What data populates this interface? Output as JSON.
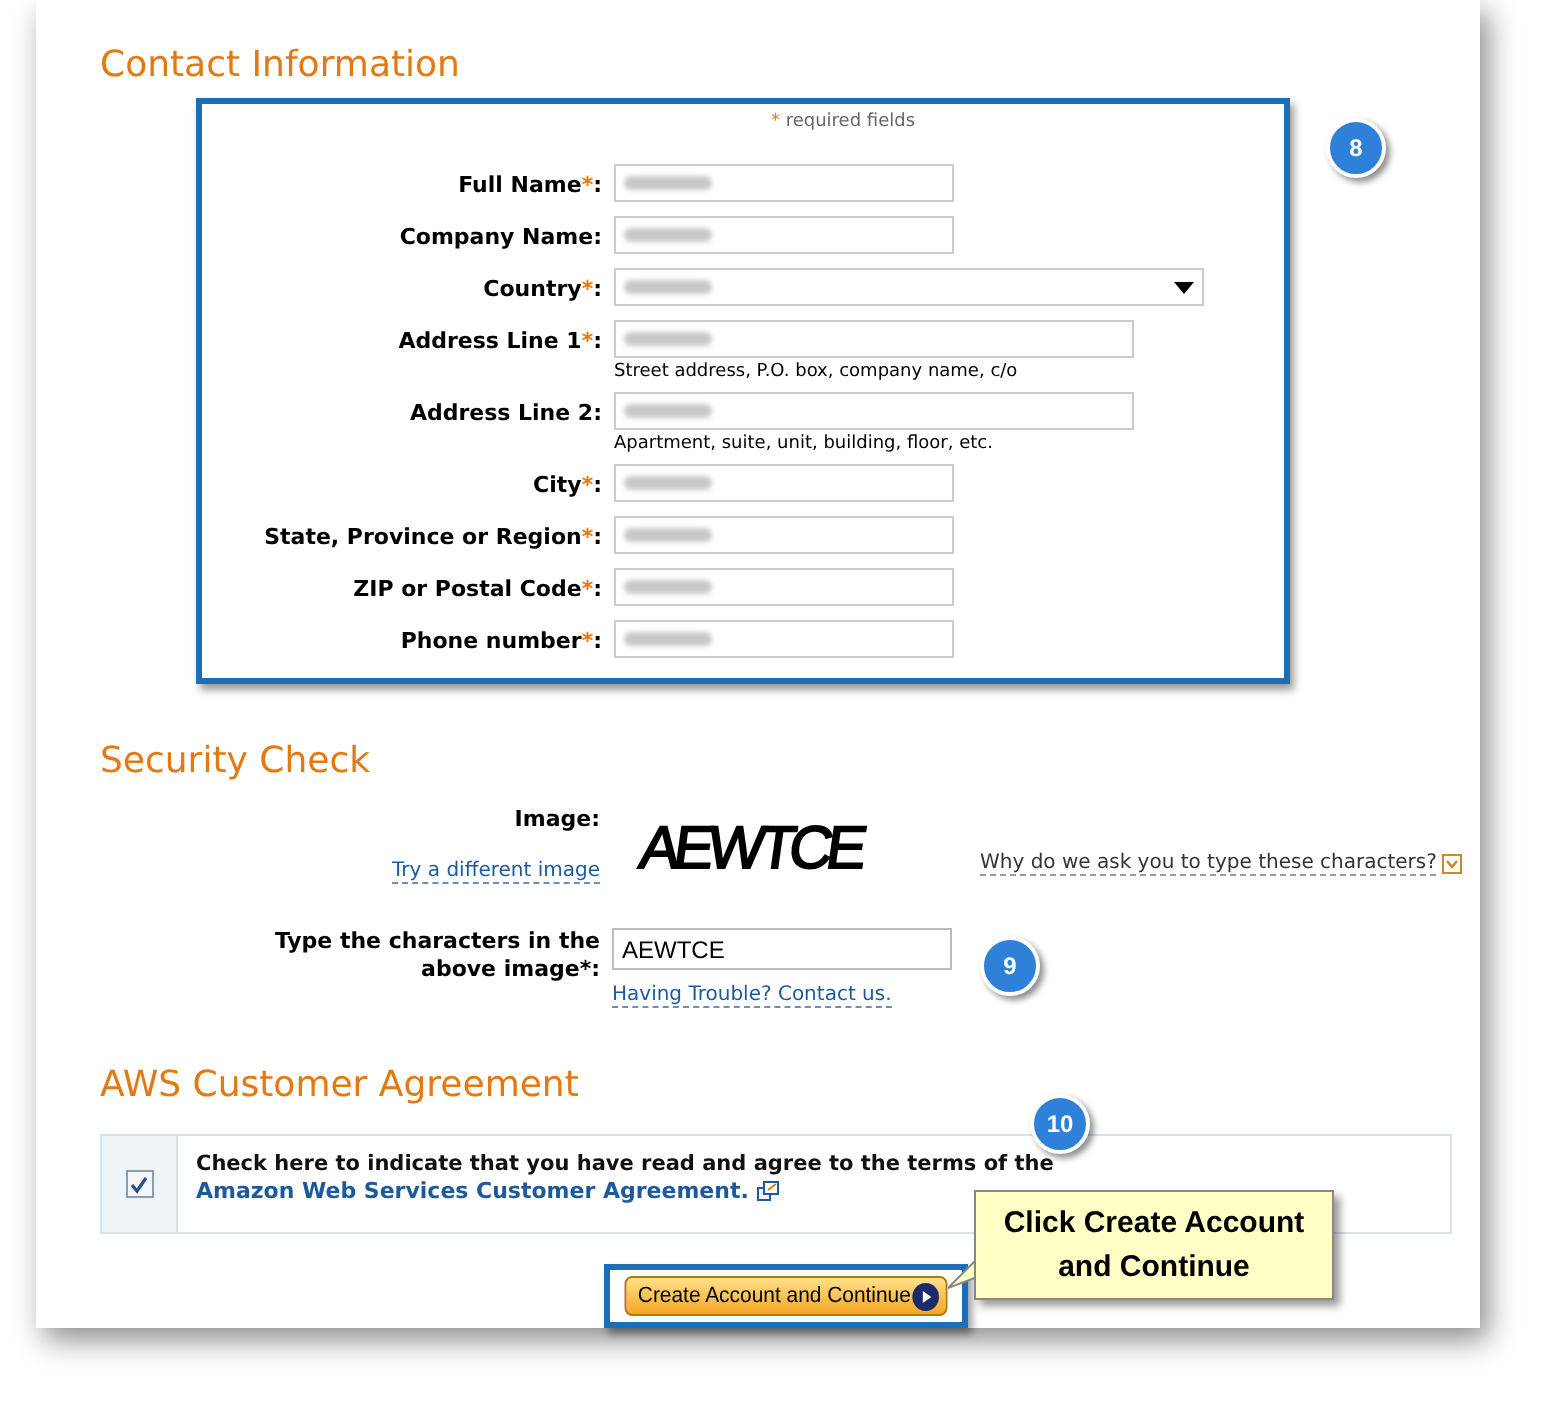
{
  "contact": {
    "title": "Contact Information",
    "required_mark": "*",
    "label_suffix": ":",
    "required_note": "required fields",
    "step": "8",
    "fields": [
      {
        "label": "Full Name",
        "required": true,
        "kind": "text",
        "blurred": true
      },
      {
        "label": "Company Name",
        "required": false,
        "kind": "text",
        "blurred": true
      },
      {
        "label": "Country",
        "required": true,
        "kind": "select",
        "blurred": true
      },
      {
        "label": "Address Line 1",
        "required": true,
        "kind": "text",
        "blurred": true,
        "hint": "Street address, P.O. box, company name, c/o"
      },
      {
        "label": "Address Line 2",
        "required": false,
        "kind": "text",
        "blurred": true,
        "hint": "Apartment, suite, unit, building, floor, etc."
      },
      {
        "label": "City",
        "required": true,
        "kind": "text",
        "blurred": true
      },
      {
        "label": "State, Province or Region",
        "required": true,
        "kind": "text",
        "blurred": true
      },
      {
        "label": "ZIP or Postal Code",
        "required": true,
        "kind": "text",
        "blurred": true
      },
      {
        "label": "Phone number",
        "required": true,
        "kind": "text",
        "blurred": true
      }
    ]
  },
  "security": {
    "title": "Security Check",
    "image_label": "Image:",
    "try_link": "Try a different image",
    "captcha_text": "AEWTCE",
    "why_link": "Why do we ask you to type these characters?",
    "type_label": "Type the characters in the above image*:",
    "value": "AEWTCE",
    "help_link": "Having Trouble? Contact us.",
    "step": "9"
  },
  "agreement": {
    "title": "AWS Customer Agreement",
    "checked": true,
    "text": "Check here to indicate that you have read and agree to the terms of the",
    "link": "Amazon Web Services Customer Agreement.",
    "step": "10"
  },
  "submit": {
    "label": "Create Account and Continue"
  },
  "callout": {
    "text": "Click Create Account and Continue"
  }
}
